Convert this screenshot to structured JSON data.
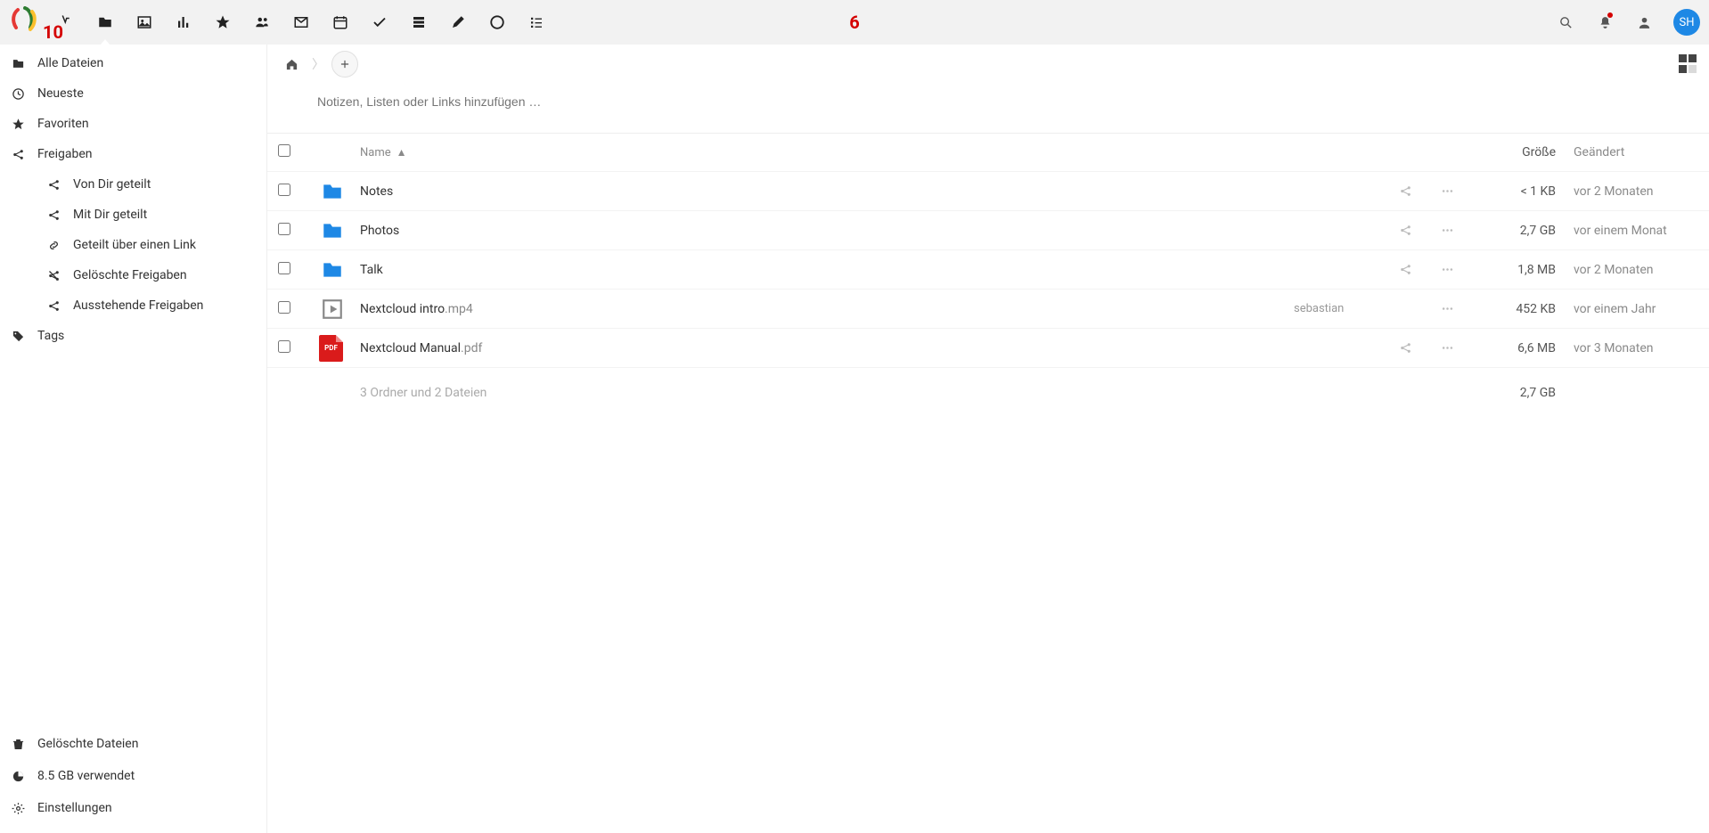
{
  "annotations": {
    "top_center": "6",
    "logo_overlay": "10"
  },
  "avatar_initials": "SH",
  "notes_placeholder": "Notizen, Listen oder Links hinzufügen …",
  "sidebar": {
    "items": [
      {
        "icon": "folder",
        "label": "Alle Dateien"
      },
      {
        "icon": "clock",
        "label": "Neueste"
      },
      {
        "icon": "star",
        "label": "Favoriten"
      },
      {
        "icon": "share",
        "label": "Freigaben"
      }
    ],
    "share_sub": [
      {
        "icon": "share",
        "label": "Von Dir geteilt"
      },
      {
        "icon": "share",
        "label": "Mit Dir geteilt"
      },
      {
        "icon": "link",
        "label": "Geteilt über einen Link"
      },
      {
        "icon": "unshare",
        "label": "Gelöschte Freigaben"
      },
      {
        "icon": "share",
        "label": "Ausstehende Freigaben"
      }
    ],
    "tags": {
      "icon": "tag",
      "label": "Tags"
    },
    "bottom": [
      {
        "icon": "trash",
        "label": "Gelöschte Dateien"
      },
      {
        "icon": "pie",
        "label": "8.5 GB verwendet"
      },
      {
        "icon": "gear",
        "label": "Einstellungen"
      }
    ]
  },
  "columns": {
    "name": "Name",
    "size": "Größe",
    "modified": "Geändert"
  },
  "files": [
    {
      "type": "folder",
      "name": "Notes",
      "ext": "",
      "shared": "",
      "size": "< 1 KB",
      "modified": "vor 2 Monaten"
    },
    {
      "type": "folder",
      "name": "Photos",
      "ext": "",
      "shared": "",
      "size": "2,7 GB",
      "modified": "vor einem Monat"
    },
    {
      "type": "folder",
      "name": "Talk",
      "ext": "",
      "shared": "",
      "size": "1,8 MB",
      "modified": "vor 2 Monaten"
    },
    {
      "type": "video",
      "name": "Nextcloud intro",
      "ext": ".mp4",
      "shared": "sebastian",
      "size": "452 KB",
      "modified": "vor einem Jahr"
    },
    {
      "type": "pdf",
      "name": "Nextcloud Manual",
      "ext": ".pdf",
      "shared": "",
      "size": "6,6 MB",
      "modified": "vor 3 Monaten"
    }
  ],
  "summary": {
    "text": "3 Ordner und 2 Dateien",
    "size": "2,7 GB"
  },
  "pdf_label": "PDF"
}
